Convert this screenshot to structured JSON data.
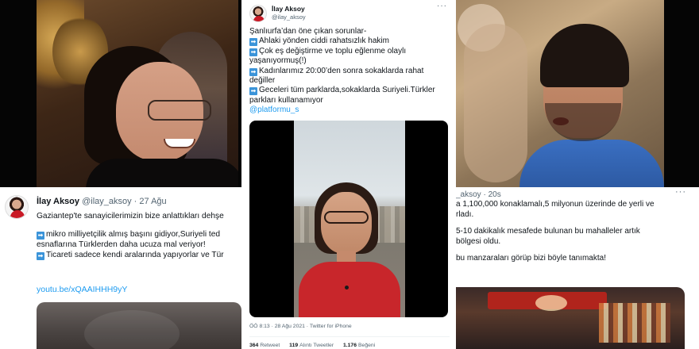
{
  "left_tweet": {
    "name": "İlay Aksoy",
    "handle": "@ilay_aksoy",
    "dot": "·",
    "date": "27 Ağu",
    "lines": [
      "Gaziantep'te sanayicilerimizin bize anlattıkları dehşe",
      "",
      "mikro milliyetçilik almış başını gidiyor,Suriyeli ted",
      "esnaflarına Türklerden daha ucuza mal veriyor!",
      "Ticareti sadece kendi aralarında yapıyorlar ve Tür"
    ],
    "link": "youtu.be/xQAAIHHH9yY",
    "arrow_glyph": "➡"
  },
  "middle_tweet": {
    "name": "İlay Aksoy",
    "handle": "@ilay_aksoy",
    "more": "···",
    "lines": [
      "Şanlıurfa’dan öne çıkan sorunlar-",
      "Ahlaki yönden ciddi rahatsızlık hakim",
      "Çok eş değiştirme ve toplu eğlenme olaylı",
      "yaşanıyormuş(!)",
      "Kadınlarımız  20:00’den sonra sokaklarda rahat",
      "değiller",
      "Geceleri tüm parklarda,sokaklarda Suriyeli.Türkler",
      "parkları kullanamıyor"
    ],
    "mention": "@platformu_s",
    "meta": "ÖÖ 8:13 · 28 Ağu 2021 · Twitter for iPhone",
    "stats": [
      {
        "count": "364",
        "label": "Retweet"
      },
      {
        "count": "119",
        "label": "Alıntı Tweetler"
      },
      {
        "count": "1.176",
        "label": "Beğeni"
      }
    ]
  },
  "right_tweet": {
    "header": "_aksoy · 20s",
    "more": "···",
    "lines": [
      "a 1,100,000 konaklamalı,5 milyonun üzerinde de yerli ve",
      "rladı.",
      "",
      "5-10 dakikalık mesafede bulunan bu mahalleler artık",
      "bölgesi oldu.",
      "",
      "bu manzaraları görüp bizi böyle tanımakta!"
    ]
  },
  "colors": {
    "link": "#1d9bf0",
    "secondary_text": "#536471",
    "arrow_box": "#3b94d9"
  },
  "icons": [
    "arrow-right-icon",
    "more-options-icon",
    "avatar"
  ]
}
